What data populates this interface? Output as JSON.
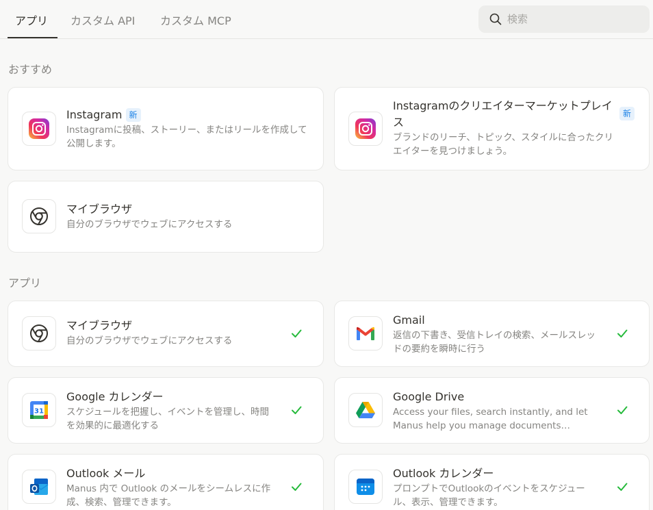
{
  "tabs": [
    {
      "label": "アプリ",
      "active": true
    },
    {
      "label": "カスタム API",
      "active": false
    },
    {
      "label": "カスタム MCP",
      "active": false
    }
  ],
  "search": {
    "placeholder": "検索",
    "value": ""
  },
  "sections": {
    "recommended": "おすすめ",
    "apps": "アプリ"
  },
  "recommended": [
    {
      "title": "Instagram",
      "badge": "新",
      "desc": "Instagramに投稿、ストーリー、またはリールを作成して公開します。",
      "icon": "instagram-icon"
    },
    {
      "title": "Instagramのクリエイターマーケットプレイス",
      "badge": "新",
      "desc": "ブランドのリーチ、トピック、スタイルに合ったクリエイターを見つけましょう。",
      "icon": "instagram-icon"
    },
    {
      "title": "マイブラウザ",
      "desc": "自分のブラウザでウェブにアクセスする",
      "icon": "chrome-icon"
    }
  ],
  "apps": [
    {
      "title": "マイブラウザ",
      "desc": "自分のブラウザでウェブにアクセスする",
      "icon": "chrome-icon",
      "connected": true
    },
    {
      "title": "Gmail",
      "desc": "返信の下書き、受信トレイの検索、メールスレッドの要約を瞬時に行う",
      "icon": "gmail-icon",
      "connected": true
    },
    {
      "title": "Google カレンダー",
      "desc": "スケジュールを把握し、イベントを管理し、時間を効果的に最適化する",
      "icon": "google-calendar-icon",
      "calendar_day": "31",
      "connected": true
    },
    {
      "title": "Google Drive",
      "desc": "Access your files, search instantly, and let Manus help you manage documents…",
      "icon": "google-drive-icon",
      "connected": true
    },
    {
      "title": "Outlook メール",
      "desc": "Manus 内で Outlook のメールをシームレスに作成、検索、管理できます。",
      "icon": "outlook-mail-icon",
      "connected": true
    },
    {
      "title": "Outlook カレンダー",
      "desc": "プロンプトでOutlookのイベントをスケジュール、表示、管理できます。",
      "icon": "outlook-calendar-icon",
      "connected": true
    }
  ],
  "colors": {
    "check": "#25ba3b",
    "badge": "#1a81e6"
  }
}
